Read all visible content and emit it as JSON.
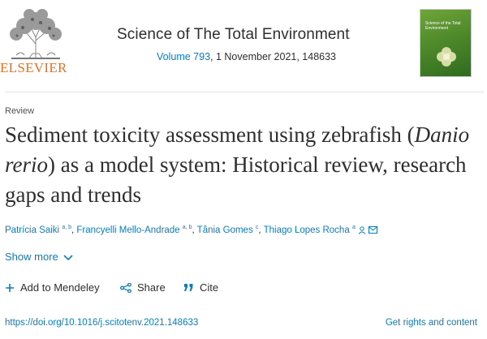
{
  "publisher": {
    "name": "ELSEVIER"
  },
  "journal": {
    "title": "Science of The Total Environment",
    "volume_link": "Volume 793",
    "issue_rest": ", 1 November 2021, 148633",
    "cover_text": "Science of the Total Environment"
  },
  "article": {
    "type": "Review",
    "title_part1": "Sediment toxicity assessment using zebrafish (",
    "title_species": "Danio rerio",
    "title_part2": ") as a model system: Historical review, research gaps and trends"
  },
  "authors": [
    {
      "name": "Patrícia Saiki",
      "aff": "a, b"
    },
    {
      "name": "Francyelli Mello-Andrade",
      "aff": "a, b"
    },
    {
      "name": "Tânia Gomes",
      "aff": "c"
    },
    {
      "name": "Thiago Lopes Rocha",
      "aff": "a"
    }
  ],
  "show_more": "Show more",
  "actions": {
    "mendeley": "Add to Mendeley",
    "share": "Share",
    "cite": "Cite"
  },
  "footer": {
    "doi": "https://doi.org/10.1016/j.scitotenv.2021.148633",
    "rights": "Get rights and content"
  },
  "colors": {
    "link": "#0c7dbb",
    "brand": "#e9711c",
    "text": "#2e2e2e"
  }
}
